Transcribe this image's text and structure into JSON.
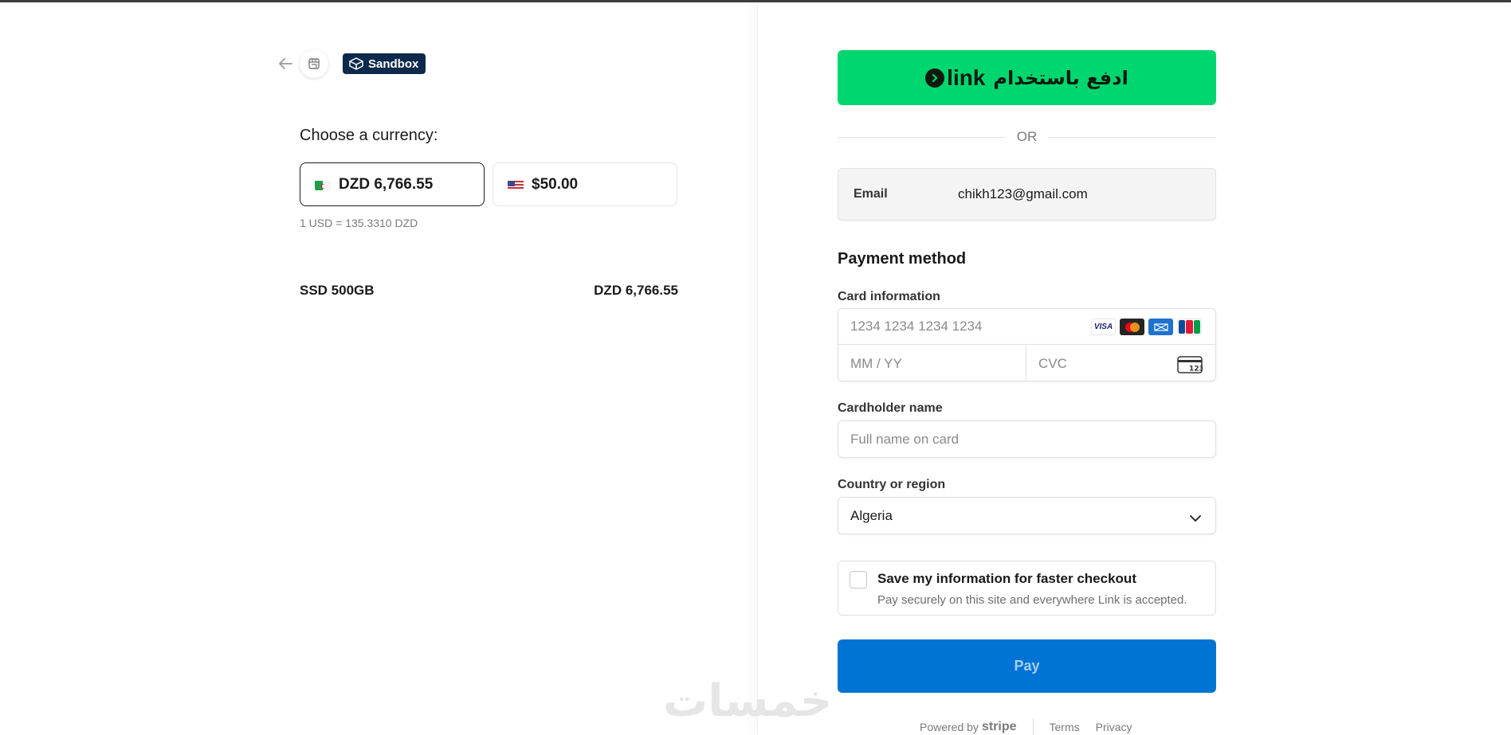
{
  "header": {
    "sandbox_label": "Sandbox"
  },
  "currency": {
    "title": "Choose a currency:",
    "options": [
      {
        "label": "DZD 6,766.55",
        "selected": true
      },
      {
        "label": "$50.00",
        "selected": false
      }
    ],
    "rate": "1 USD = 135.3310 DZD"
  },
  "order": {
    "item_name": "SSD 500GB",
    "item_price": "DZD 6,766.55"
  },
  "link_button": {
    "text_ar": "ادفع باستخدام",
    "logo_text": "link"
  },
  "divider": {
    "or_label": "OR"
  },
  "email": {
    "label": "Email",
    "value": "chikh123@gmail.com"
  },
  "payment": {
    "title": "Payment method",
    "card_label": "Card information",
    "card_number_placeholder": "1234 1234 1234 1234",
    "expiry_placeholder": "MM / YY",
    "cvc_placeholder": "CVC",
    "brands": [
      "VISA",
      "mastercard",
      "amex",
      "JCB"
    ],
    "cvc_icon_text": "123",
    "cardholder_label": "Cardholder name",
    "cardholder_placeholder": "Full name on card",
    "country_label": "Country or region",
    "country_value": "Algeria"
  },
  "save_info": {
    "title": "Save my information for faster checkout",
    "subtitle": "Pay securely on this site and everywhere Link is accepted."
  },
  "pay_button": {
    "label": "Pay"
  },
  "footer": {
    "powered_by": "Powered by",
    "stripe": "stripe",
    "terms": "Terms",
    "privacy": "Privacy"
  },
  "watermark": {
    "text": "خمسات"
  },
  "colors": {
    "link_green": "#00d66f",
    "pay_blue": "#0074d4",
    "sandbox_bg": "#0d2a4d"
  }
}
